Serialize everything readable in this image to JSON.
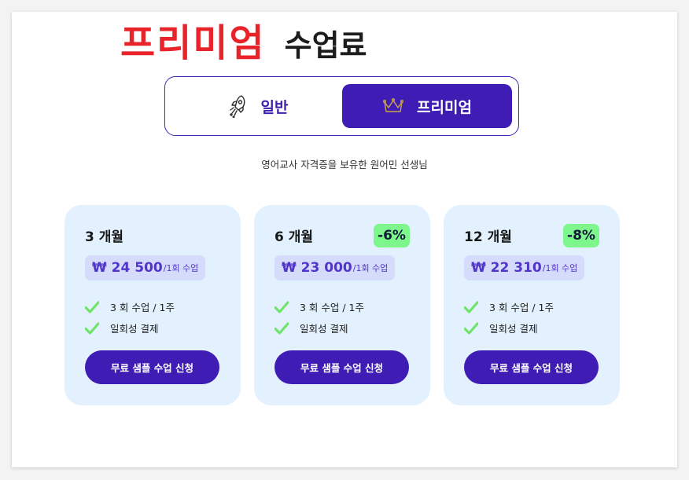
{
  "header": {
    "title_accent": "프리미엄",
    "title_rest": "수업료"
  },
  "toggle": {
    "options": [
      {
        "label": "일반",
        "icon": "rocket-icon",
        "selected": false
      },
      {
        "label": "프리미엄",
        "icon": "crown-icon",
        "selected": true
      }
    ]
  },
  "subtitle": "영어교사 자격증을 보유한 원어민 선생님",
  "plans": [
    {
      "title": "3 개월",
      "discount": "",
      "price": "₩ 24 500",
      "unit": "/1회 수업",
      "features": [
        "3 회 수업 / 1주",
        "일회성 결제"
      ],
      "cta": "무료 샘플 수업 신청"
    },
    {
      "title": "6 개월",
      "discount": "-6%",
      "price": "₩ 23 000",
      "unit": "/1회 수업",
      "features": [
        "3 회 수업 / 1주",
        "일회성 결제"
      ],
      "cta": "무료 샘플 수업 신청"
    },
    {
      "title": "12 개월",
      "discount": "-8%",
      "price": "₩ 22 310",
      "unit": "/1회 수업",
      "features": [
        "3 회 수업 / 1주",
        "일회성 결제"
      ],
      "cta": "무료 샘플 수업 신청"
    }
  ],
  "colors": {
    "accent_red": "#e8242a",
    "brand_purple": "#3f1db5",
    "card_bg": "#e2f1fd",
    "discount_green": "#7df68c",
    "check_green": "#6fe36a"
  }
}
